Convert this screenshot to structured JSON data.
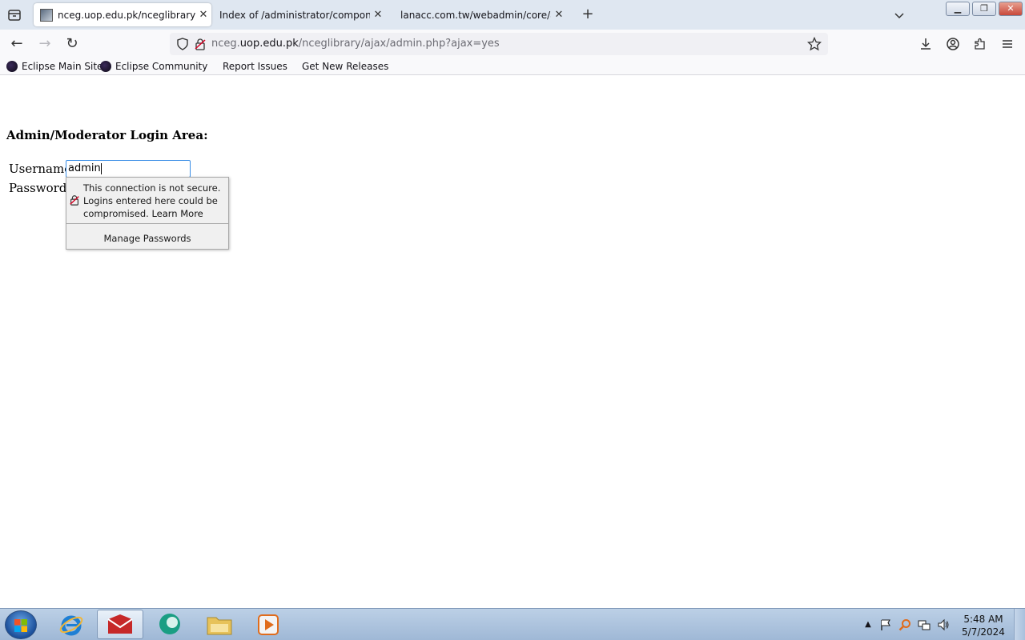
{
  "browser": {
    "tabs": [
      {
        "title": "nceg.uop.edu.pk/nceglibrary/a",
        "active": true
      },
      {
        "title": "Index of /administrator/component",
        "active": false
      },
      {
        "title": "lanacc.com.tw/webadmin/core/adi",
        "active": false
      }
    ],
    "url_prefix": "nceg.",
    "url_host": "uop.edu.pk",
    "url_path": "/nceglibrary/ajax/admin.php?ajax=yes",
    "bookmarks": [
      "Eclipse Main Site",
      "Eclipse Community",
      "Report Issues",
      "Get New Releases"
    ]
  },
  "page": {
    "heading": "Admin/Moderator Login Area:",
    "username_label": "Username:",
    "password_label": "Password:",
    "username_value": "admin"
  },
  "popup": {
    "message": "This connection is not secure. Logins entered here could be compromised.",
    "learn_more": "Learn More",
    "manage_passwords": "Manage Passwords"
  },
  "taskbar": {
    "time": "5:48 AM",
    "date": "5/7/2024"
  },
  "colors": {
    "tabstrip_bg": "#dfe7f1",
    "input_focus": "#3a8ee6",
    "taskbar": "#9fb8d6"
  }
}
